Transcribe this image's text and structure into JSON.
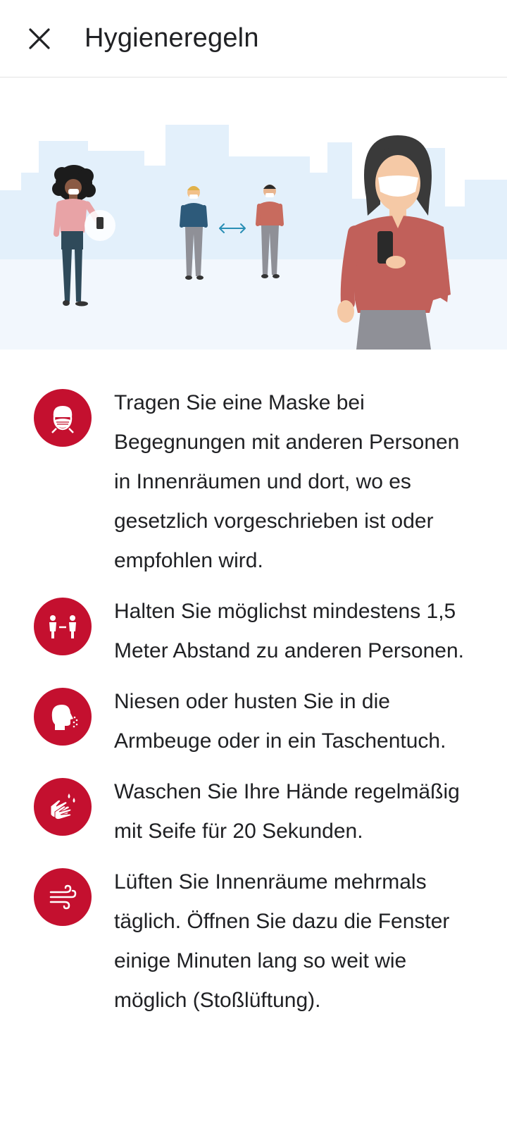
{
  "header": {
    "title": "Hygieneregeln",
    "close_icon": "close-icon"
  },
  "illustration": {
    "name": "hygiene-illustration",
    "arrow_color": "#2a8fb5"
  },
  "colors": {
    "accent": "#c4102f",
    "divider": "#e3e3e3",
    "sky": "#e3f0fb"
  },
  "rules": [
    {
      "icon": "mask-icon",
      "text": "Tragen Sie eine Maske bei Begegnungen mit anderen Personen in Innenräumen und dort, wo es gesetzlich vorgeschrieben ist oder empfohlen wird."
    },
    {
      "icon": "distance-icon",
      "text": "Halten Sie möglichst mindestens 1,5 Meter Abstand zu anderen Personen."
    },
    {
      "icon": "sneeze-icon",
      "text": "Niesen oder husten Sie in die Armbeuge oder in ein Taschentuch."
    },
    {
      "icon": "handwash-icon",
      "text": "Waschen Sie Ihre Hände regelmäßig mit Seife für 20 Sekunden."
    },
    {
      "icon": "ventilation-icon",
      "text": "Lüften Sie Innenräume mehrmals täglich. Öffnen Sie dazu die Fenster einige Minuten lang so weit wie möglich (Stoßlüftung)."
    }
  ]
}
